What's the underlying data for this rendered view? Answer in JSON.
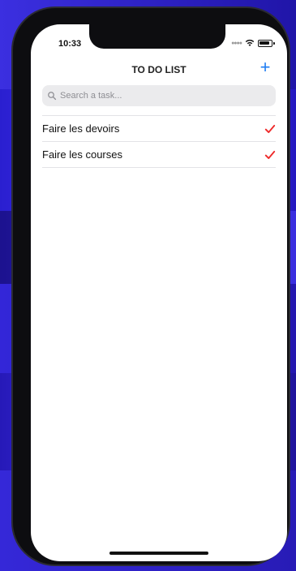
{
  "status_bar": {
    "time": "10:33",
    "signal_icon": "signal-dots-icon",
    "wifi_icon": "wifi-icon",
    "battery_icon": "battery-icon"
  },
  "header": {
    "title": "TO DO LIST",
    "add_icon": "plus-icon",
    "add_glyph": "+",
    "accent_color": "#1e7cf2"
  },
  "search": {
    "placeholder": "Search a task...",
    "value": "",
    "icon": "search-icon"
  },
  "tasks": [
    {
      "label": "Faire les devoirs",
      "done": true,
      "check_icon": "checkmark-icon"
    },
    {
      "label": "Faire les courses",
      "done": true,
      "check_icon": "checkmark-icon"
    }
  ],
  "colors": {
    "check": "#ee2a2a",
    "background": "#2a1fb8"
  }
}
